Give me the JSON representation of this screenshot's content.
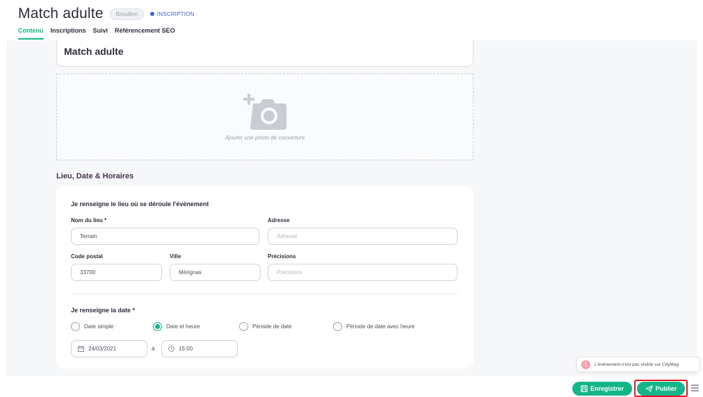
{
  "header": {
    "title": "Match adulte",
    "draft_badge": "Brouillon",
    "status_badge": "INSCRIPTION",
    "tabs": [
      {
        "label": "Contenu",
        "active": true
      },
      {
        "label": "Inscriptions",
        "active": false
      },
      {
        "label": "Suivi",
        "active": false
      },
      {
        "label": "Référencement SEO",
        "active": false
      }
    ]
  },
  "content": {
    "event_title": "Match adulte",
    "cover_text": "Ajouter une photo de couverture",
    "section_title": "Lieu, Date & Horaires",
    "location": {
      "heading": "Je renseigne le lieu où se déroule l'évènement",
      "venue_label": "Nom du lieu *",
      "venue_value": "Terrain",
      "address_label": "Adresse",
      "address_placeholder": "Adresse",
      "postal_label": "Code postal",
      "postal_value": "33700",
      "city_label": "Ville",
      "city_value": "Mérignas",
      "details_label": "Précisions",
      "details_placeholder": "Précisions"
    },
    "date": {
      "heading": "Je renseigne la date *",
      "options": [
        {
          "label": "Date simple",
          "checked": false
        },
        {
          "label": "Date et heure",
          "checked": true
        },
        {
          "label": "Période de date",
          "checked": false
        },
        {
          "label": "Période de date avec heure",
          "checked": false
        }
      ],
      "date_value": "24/03/2021",
      "separator": "à",
      "time_value": "15:00"
    }
  },
  "toast": {
    "message": "L'évènement n'est pas visible sur CityMag"
  },
  "footer": {
    "save_label": "Enregistrer",
    "publish_label": "Publier"
  },
  "colors": {
    "accent": "#15b58a",
    "status_blue": "#3e63c9",
    "highlight_red": "#e5121d"
  }
}
